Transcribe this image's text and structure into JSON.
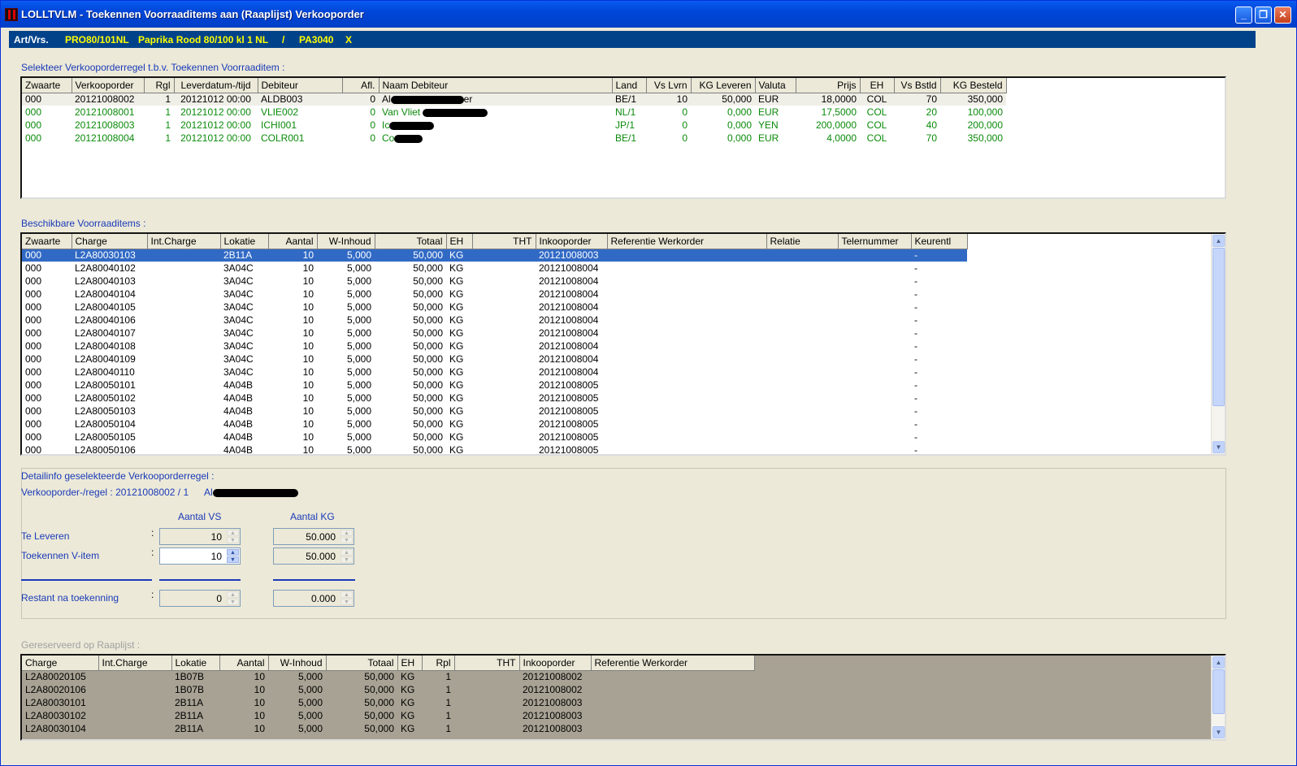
{
  "window": {
    "title": "LOLLTVLM - Toekennen Voorraaditems aan (Raaplijst) Verkooporder",
    "buttons": {
      "minimize": "_",
      "restore": "❐",
      "close": "✕"
    }
  },
  "infobar": {
    "label": "Art/Vrs.",
    "article_code": "PRO80/101NL",
    "article_desc": "Paprika Rood 80/100 kl 1 NL",
    "separator": "/",
    "variety": "PA3040",
    "extra": "X"
  },
  "orders": {
    "section_label": "Selekteer Verkooporderregel t.b.v. Toekennen Voorraaditem :",
    "columns": [
      "Zwaarte",
      "Verkooporder",
      "Rgl",
      "Leverdatum-/tijd",
      "Debiteur",
      "Afl.",
      "Naam Debiteur",
      "Land",
      "Vs Lvrn",
      "KG Leveren",
      "Valuta",
      "Prijs",
      "EH",
      "Vs Bstld",
      "KG Besteld"
    ],
    "rows": [
      {
        "zwaarte": "000",
        "order": "20121008002",
        "rgl": "1",
        "datum": "20121012 00:00",
        "debiteur": "ALDB003",
        "afl": "0",
        "naam": "Al",
        "naam_tail": "er",
        "land": "BE/1",
        "vs_lvrn": "10",
        "kg_leveren": "50,000",
        "valuta": "EUR",
        "prijs": "18,0000",
        "eh": "COL",
        "vs_bstld": "70",
        "kg_besteld": "350,000"
      },
      {
        "zwaarte": "000",
        "order": "20121008001",
        "rgl": "1",
        "datum": "20121012 00:00",
        "debiteur": "VLIE002",
        "afl": "0",
        "naam": "Van Vliet",
        "naam_tail": "",
        "land": "NL/1",
        "vs_lvrn": "0",
        "kg_leveren": "0,000",
        "valuta": "EUR",
        "prijs": "17,5000",
        "eh": "COL",
        "vs_bstld": "20",
        "kg_besteld": "100,000"
      },
      {
        "zwaarte": "000",
        "order": "20121008003",
        "rgl": "1",
        "datum": "20121012 00:00",
        "debiteur": "ICHI001",
        "afl": "0",
        "naam": "Ic",
        "naam_tail": "",
        "land": "JP/1",
        "vs_lvrn": "0",
        "kg_leveren": "0,000",
        "valuta": "YEN",
        "prijs": "200,0000",
        "eh": "COL",
        "vs_bstld": "40",
        "kg_besteld": "200,000"
      },
      {
        "zwaarte": "000",
        "order": "20121008004",
        "rgl": "1",
        "datum": "20121012 00:00",
        "debiteur": "COLR001",
        "afl": "0",
        "naam": "Co",
        "naam_tail": "",
        "land": "BE/1",
        "vs_lvrn": "0",
        "kg_leveren": "0,000",
        "valuta": "EUR",
        "prijs": "4,0000",
        "eh": "COL",
        "vs_bstld": "70",
        "kg_besteld": "350,000"
      }
    ]
  },
  "stock": {
    "section_label": "Beschikbare Voorraaditems :",
    "columns": [
      "Zwaarte",
      "Charge",
      "Int.Charge",
      "Lokatie",
      "Aantal",
      "W-Inhoud",
      "Totaal",
      "EH",
      "THT",
      "Inkooporder",
      "Referentie Werkorder",
      "Relatie",
      "Telernummer",
      "Keurentl"
    ],
    "rows": [
      [
        "000",
        "L2A80030103",
        "",
        "2B11A",
        "10",
        "5,000",
        "50,000",
        "KG",
        "",
        "20121008003",
        "",
        "",
        "",
        "-"
      ],
      [
        "000",
        "L2A80040102",
        "",
        "3A04C",
        "10",
        "5,000",
        "50,000",
        "KG",
        "",
        "20121008004",
        "",
        "",
        "",
        "-"
      ],
      [
        "000",
        "L2A80040103",
        "",
        "3A04C",
        "10",
        "5,000",
        "50,000",
        "KG",
        "",
        "20121008004",
        "",
        "",
        "",
        "-"
      ],
      [
        "000",
        "L2A80040104",
        "",
        "3A04C",
        "10",
        "5,000",
        "50,000",
        "KG",
        "",
        "20121008004",
        "",
        "",
        "",
        "-"
      ],
      [
        "000",
        "L2A80040105",
        "",
        "3A04C",
        "10",
        "5,000",
        "50,000",
        "KG",
        "",
        "20121008004",
        "",
        "",
        "",
        "-"
      ],
      [
        "000",
        "L2A80040106",
        "",
        "3A04C",
        "10",
        "5,000",
        "50,000",
        "KG",
        "",
        "20121008004",
        "",
        "",
        "",
        "-"
      ],
      [
        "000",
        "L2A80040107",
        "",
        "3A04C",
        "10",
        "5,000",
        "50,000",
        "KG",
        "",
        "20121008004",
        "",
        "",
        "",
        "-"
      ],
      [
        "000",
        "L2A80040108",
        "",
        "3A04C",
        "10",
        "5,000",
        "50,000",
        "KG",
        "",
        "20121008004",
        "",
        "",
        "",
        "-"
      ],
      [
        "000",
        "L2A80040109",
        "",
        "3A04C",
        "10",
        "5,000",
        "50,000",
        "KG",
        "",
        "20121008004",
        "",
        "",
        "",
        "-"
      ],
      [
        "000",
        "L2A80040110",
        "",
        "3A04C",
        "10",
        "5,000",
        "50,000",
        "KG",
        "",
        "20121008004",
        "",
        "",
        "",
        "-"
      ],
      [
        "000",
        "L2A80050101",
        "",
        "4A04B",
        "10",
        "5,000",
        "50,000",
        "KG",
        "",
        "20121008005",
        "",
        "",
        "",
        "-"
      ],
      [
        "000",
        "L2A80050102",
        "",
        "4A04B",
        "10",
        "5,000",
        "50,000",
        "KG",
        "",
        "20121008005",
        "",
        "",
        "",
        "-"
      ],
      [
        "000",
        "L2A80050103",
        "",
        "4A04B",
        "10",
        "5,000",
        "50,000",
        "KG",
        "",
        "20121008005",
        "",
        "",
        "",
        "-"
      ],
      [
        "000",
        "L2A80050104",
        "",
        "4A04B",
        "10",
        "5,000",
        "50,000",
        "KG",
        "",
        "20121008005",
        "",
        "",
        "",
        "-"
      ],
      [
        "000",
        "L2A80050105",
        "",
        "4A04B",
        "10",
        "5,000",
        "50,000",
        "KG",
        "",
        "20121008005",
        "",
        "",
        "",
        "-"
      ],
      [
        "000",
        "L2A80050106",
        "",
        "4A04B",
        "10",
        "5,000",
        "50,000",
        "KG",
        "",
        "20121008005",
        "",
        "",
        "",
        "-"
      ]
    ]
  },
  "detail": {
    "section_label": "Detailinfo geselekteerde Verkooporderregel :",
    "order_line": "Verkooporder-/regel : 20121008002 / 1",
    "debtor_prefix": "Al",
    "col_vs": "Aantal VS",
    "col_kg": "Aantal KG",
    "te_leveren": {
      "label": "Te Leveren",
      "vs": "10",
      "kg": "50.000"
    },
    "toekennen": {
      "label": "Toekennen V-item",
      "vs": "10",
      "kg": "50.000"
    },
    "restant": {
      "label": "Restant na toekenning",
      "vs": "0",
      "kg": "0.000"
    },
    "colon": ":"
  },
  "reserved": {
    "section_label": "Gereserveerd op Raaplijst :",
    "columns": [
      "Charge",
      "Int.Charge",
      "Lokatie",
      "Aantal",
      "W-Inhoud",
      "Totaal",
      "EH",
      "Rpl",
      "THT",
      "Inkooporder",
      "Referentie Werkorder"
    ],
    "rows": [
      [
        "L2A80020105",
        "",
        "1B07B",
        "10",
        "5,000",
        "50,000",
        "KG",
        "1",
        "",
        "20121008002",
        ""
      ],
      [
        "L2A80020106",
        "",
        "1B07B",
        "10",
        "5,000",
        "50,000",
        "KG",
        "1",
        "",
        "20121008002",
        ""
      ],
      [
        "L2A80030101",
        "",
        "2B11A",
        "10",
        "5,000",
        "50,000",
        "KG",
        "1",
        "",
        "20121008003",
        ""
      ],
      [
        "L2A80030102",
        "",
        "2B11A",
        "10",
        "5,000",
        "50,000",
        "KG",
        "1",
        "",
        "20121008003",
        ""
      ],
      [
        "L2A80030104",
        "",
        "2B11A",
        "10",
        "5,000",
        "50,000",
        "KG",
        "1",
        "",
        "20121008003",
        ""
      ]
    ]
  },
  "colors": {
    "titlebar": "#0046d8",
    "infobar": "#00428a",
    "infobar_text": "#ffff00",
    "label_blue": "#1a3ab8",
    "order_green": "#0a8a0a",
    "selection": "#316ac5",
    "reserved_bg": "#a8a294"
  },
  "icons": {
    "app": "app-icon",
    "minimize": "minimize-icon",
    "restore": "restore-icon",
    "close": "close-icon",
    "scroll_up": "scroll-up-arrow-icon",
    "scroll_down": "scroll-down-arrow-icon",
    "spin_up": "spin-up-arrow-icon",
    "spin_down": "spin-down-arrow-icon"
  }
}
